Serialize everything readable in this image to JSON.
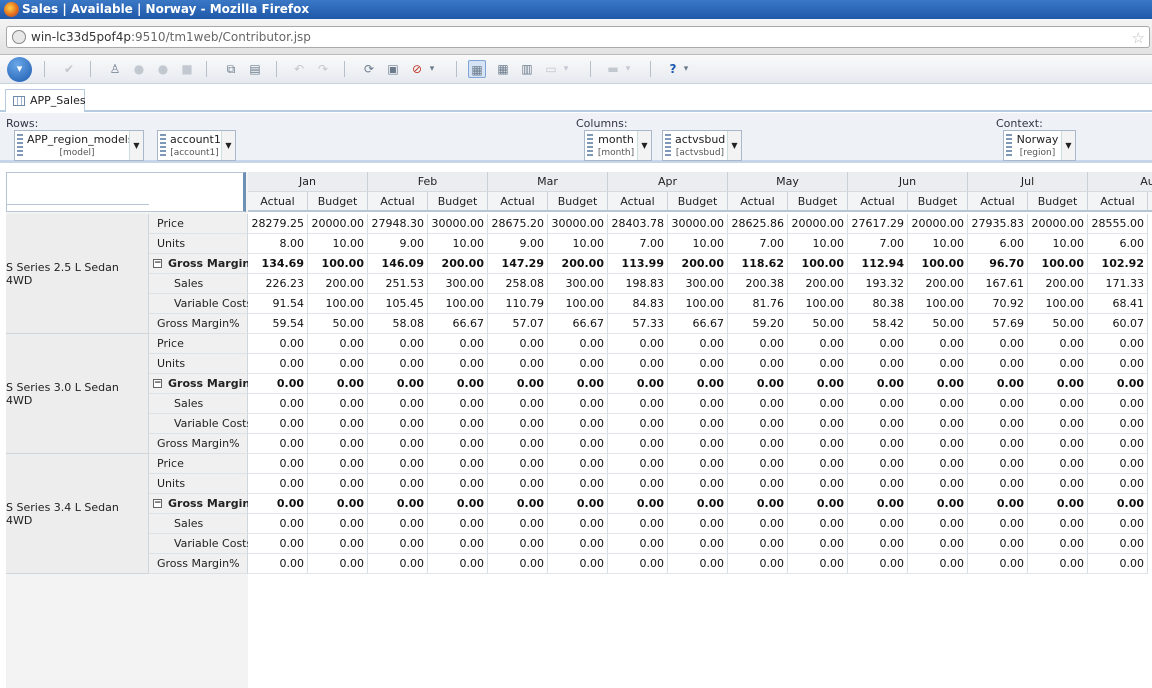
{
  "window": {
    "title": "Sales | Available | Norway - Mozilla Firefox"
  },
  "address": {
    "host": "win-lc33d5pof4p",
    "path": ":9510/tm1web/Contributor.jsp"
  },
  "tab": {
    "label": "APP_Sales"
  },
  "rows": {
    "label": "Rows:",
    "dims": [
      {
        "name": "APP_region_models",
        "sub": "[model]"
      },
      {
        "name": "account1",
        "sub": "[account1]"
      }
    ]
  },
  "columns": {
    "label": "Columns:",
    "dims": [
      {
        "name": "month",
        "sub": "[month]"
      },
      {
        "name": "actvsbud",
        "sub": "[actvsbud]"
      }
    ]
  },
  "context": {
    "label": "Context:",
    "dims": [
      {
        "name": "Norway",
        "sub": "[region]"
      }
    ]
  },
  "grid": {
    "months": [
      "Jan",
      "Feb",
      "Mar",
      "Apr",
      "May",
      "Jun",
      "Jul",
      "Au"
    ],
    "subcols": [
      "Actual",
      "Budget"
    ],
    "models": [
      "S Series 2.5 L Sedan 4WD",
      "S Series 3.0 L Sedan 4WD",
      "S Series 3.4 L Sedan 4WD"
    ],
    "accounts": [
      "Price",
      "Units",
      "Gross Margin",
      "Sales",
      "Variable Costs",
      "Gross Margin%"
    ],
    "values": [
      [
        [
          "28279.25",
          "20000.00",
          "27948.30",
          "30000.00",
          "28675.20",
          "30000.00",
          "28403.78",
          "30000.00",
          "28625.86",
          "20000.00",
          "27617.29",
          "20000.00",
          "27935.83",
          "20000.00",
          "28555.00"
        ],
        [
          "8.00",
          "10.00",
          "9.00",
          "10.00",
          "9.00",
          "10.00",
          "7.00",
          "10.00",
          "7.00",
          "10.00",
          "7.00",
          "10.00",
          "6.00",
          "10.00",
          "6.00"
        ],
        [
          "134.69",
          "100.00",
          "146.09",
          "200.00",
          "147.29",
          "200.00",
          "113.99",
          "200.00",
          "118.62",
          "100.00",
          "112.94",
          "100.00",
          "96.70",
          "100.00",
          "102.92"
        ],
        [
          "226.23",
          "200.00",
          "251.53",
          "300.00",
          "258.08",
          "300.00",
          "198.83",
          "300.00",
          "200.38",
          "200.00",
          "193.32",
          "200.00",
          "167.61",
          "200.00",
          "171.33"
        ],
        [
          "91.54",
          "100.00",
          "105.45",
          "100.00",
          "110.79",
          "100.00",
          "84.83",
          "100.00",
          "81.76",
          "100.00",
          "80.38",
          "100.00",
          "70.92",
          "100.00",
          "68.41"
        ],
        [
          "59.54",
          "50.00",
          "58.08",
          "66.67",
          "57.07",
          "66.67",
          "57.33",
          "66.67",
          "59.20",
          "50.00",
          "58.42",
          "50.00",
          "57.69",
          "50.00",
          "60.07"
        ]
      ],
      [
        [
          "0.00",
          "0.00",
          "0.00",
          "0.00",
          "0.00",
          "0.00",
          "0.00",
          "0.00",
          "0.00",
          "0.00",
          "0.00",
          "0.00",
          "0.00",
          "0.00",
          "0.00"
        ],
        [
          "0.00",
          "0.00",
          "0.00",
          "0.00",
          "0.00",
          "0.00",
          "0.00",
          "0.00",
          "0.00",
          "0.00",
          "0.00",
          "0.00",
          "0.00",
          "0.00",
          "0.00"
        ],
        [
          "0.00",
          "0.00",
          "0.00",
          "0.00",
          "0.00",
          "0.00",
          "0.00",
          "0.00",
          "0.00",
          "0.00",
          "0.00",
          "0.00",
          "0.00",
          "0.00",
          "0.00"
        ],
        [
          "0.00",
          "0.00",
          "0.00",
          "0.00",
          "0.00",
          "0.00",
          "0.00",
          "0.00",
          "0.00",
          "0.00",
          "0.00",
          "0.00",
          "0.00",
          "0.00",
          "0.00"
        ],
        [
          "0.00",
          "0.00",
          "0.00",
          "0.00",
          "0.00",
          "0.00",
          "0.00",
          "0.00",
          "0.00",
          "0.00",
          "0.00",
          "0.00",
          "0.00",
          "0.00",
          "0.00"
        ],
        [
          "0.00",
          "0.00",
          "0.00",
          "0.00",
          "0.00",
          "0.00",
          "0.00",
          "0.00",
          "0.00",
          "0.00",
          "0.00",
          "0.00",
          "0.00",
          "0.00",
          "0.00"
        ]
      ],
      [
        [
          "0.00",
          "0.00",
          "0.00",
          "0.00",
          "0.00",
          "0.00",
          "0.00",
          "0.00",
          "0.00",
          "0.00",
          "0.00",
          "0.00",
          "0.00",
          "0.00",
          "0.00"
        ],
        [
          "0.00",
          "0.00",
          "0.00",
          "0.00",
          "0.00",
          "0.00",
          "0.00",
          "0.00",
          "0.00",
          "0.00",
          "0.00",
          "0.00",
          "0.00",
          "0.00",
          "0.00"
        ],
        [
          "0.00",
          "0.00",
          "0.00",
          "0.00",
          "0.00",
          "0.00",
          "0.00",
          "0.00",
          "0.00",
          "0.00",
          "0.00",
          "0.00",
          "0.00",
          "0.00",
          "0.00"
        ],
        [
          "0.00",
          "0.00",
          "0.00",
          "0.00",
          "0.00",
          "0.00",
          "0.00",
          "0.00",
          "0.00",
          "0.00",
          "0.00",
          "0.00",
          "0.00",
          "0.00",
          "0.00"
        ],
        [
          "0.00",
          "0.00",
          "0.00",
          "0.00",
          "0.00",
          "0.00",
          "0.00",
          "0.00",
          "0.00",
          "0.00",
          "0.00",
          "0.00",
          "0.00",
          "0.00",
          "0.00"
        ],
        [
          "0.00",
          "0.00",
          "0.00",
          "0.00",
          "0.00",
          "0.00",
          "0.00",
          "0.00",
          "0.00",
          "0.00",
          "0.00",
          "0.00",
          "0.00",
          "0.00",
          "0.00"
        ]
      ]
    ]
  },
  "colors": {
    "titlebar": "#2a66b6",
    "grid_border": "#d6dde5",
    "header_bg": "#ebedf0"
  }
}
